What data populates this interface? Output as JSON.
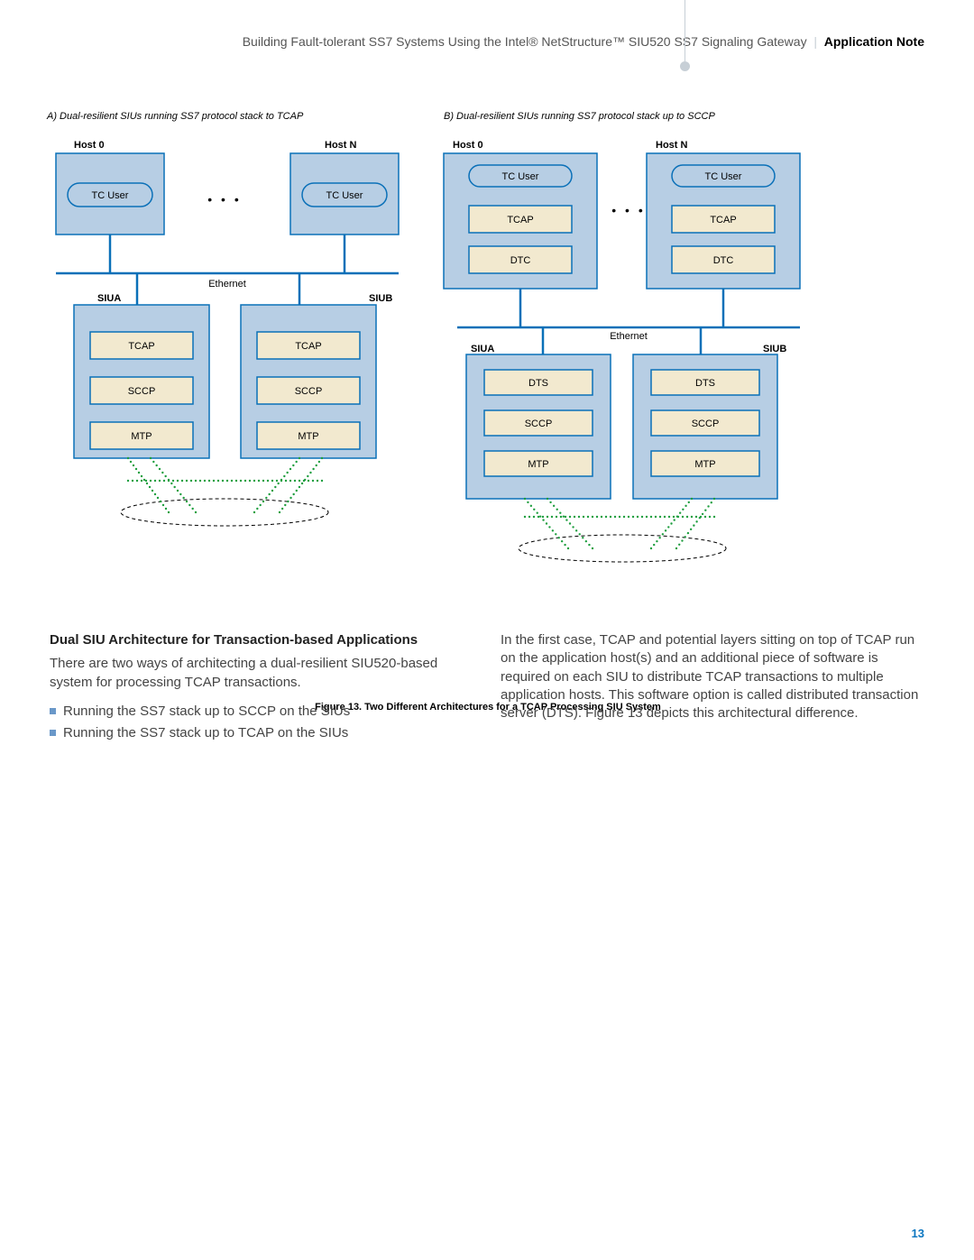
{
  "header": {
    "title": "Building Fault-tolerant SS7 Systems Using the Intel® NetStructure™ SIU520 SS7 Signaling Gateway",
    "badge": "Application Note"
  },
  "figure": {
    "captionA": "A) Dual-resilient SIUs running SS7 protocol stack to TCAP",
    "captionB": "B) Dual-resilient SIUs running SS7 protocol stack up to SCCP",
    "host0": "Host 0",
    "hostN": "Host N",
    "siuA": "SIUA",
    "siuB": "SIUB",
    "ethernet": "Ethernet",
    "ellipsis": "• • •",
    "layers": {
      "tcuser": "TC User",
      "tcap": "TCAP",
      "sccp": "SCCP",
      "mtp": "MTP",
      "dtc": "DTC",
      "dts": "DTS"
    },
    "caption": "Figure 13. Two Different Architectures for a TCAP Processing SIU System"
  },
  "body": {
    "section_title": "Dual SIU Architecture for Transaction-based Applications",
    "intro": "There are two ways of architecting a dual-resilient SIU520-based system for processing TCAP transactions.",
    "bullets": [
      "Running the SS7 stack up to SCCP on the SIUs",
      "Running the SS7 stack up to TCAP on the SIUs"
    ],
    "right": "In the first case, TCAP and potential layers sitting on top of TCAP run on the application host(s) and an additional piece of software is required on each SIU to distribute TCAP transactions to multiple application hosts. This software option is called distributed transaction server (DTS). Figure 13 depicts this architectural difference."
  },
  "page_number": "13"
}
